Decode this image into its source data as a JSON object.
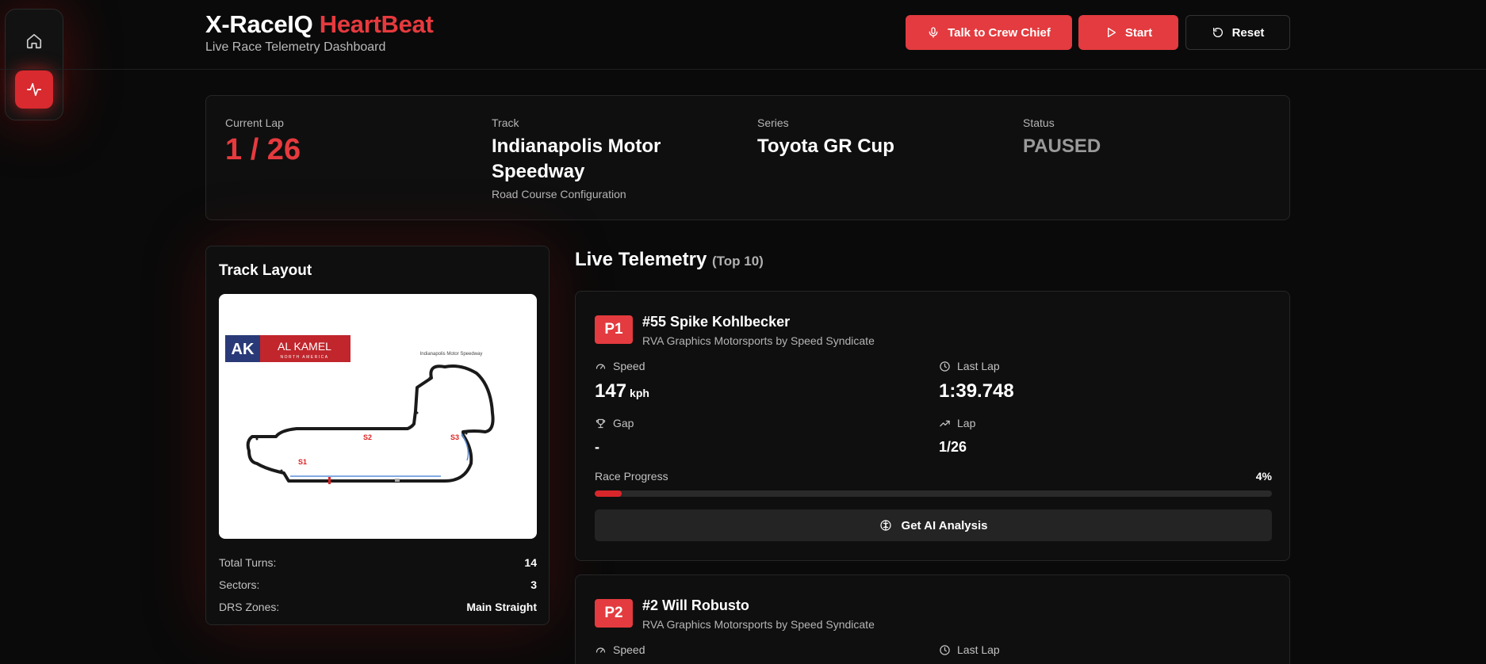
{
  "app": {
    "title_main": "X-RaceIQ",
    "title_accent": "HeartBeat",
    "subtitle": "Live Race Telemetry Dashboard"
  },
  "nav": {
    "items": [
      {
        "icon": "home-icon"
      },
      {
        "icon": "activity-icon",
        "active": true
      }
    ]
  },
  "header": {
    "crew_label": "Talk to Crew Chief",
    "start_label": "Start",
    "reset_label": "Reset"
  },
  "race_info": {
    "lap_label": "Current Lap",
    "lap_value": "1 / 26",
    "track_label": "Track",
    "track_value": "Indianapolis Motor Speedway",
    "track_sub": "Road Course Configuration",
    "series_label": "Series",
    "series_value": "Toyota GR Cup",
    "status_label": "Status",
    "status_value": "PAUSED"
  },
  "track_layout": {
    "title": "Track Layout",
    "logo_ak": "AK",
    "logo_name": "AL KAMEL",
    "logo_sub": "NORTH AMERICA",
    "map_title": "Indianapolis Motor Speedway",
    "sector_labels": [
      "S1",
      "S2",
      "S3"
    ],
    "stats": [
      {
        "label": "Total Turns:",
        "value": "14"
      },
      {
        "label": "Sectors:",
        "value": "3"
      },
      {
        "label": "DRS Zones:",
        "value": "Main Straight"
      }
    ]
  },
  "telemetry": {
    "title": "Live Telemetry",
    "title_sub": "(Top 10)",
    "progress_label": "Race Progress",
    "ai_label": "Get AI Analysis",
    "speed_label": "Speed",
    "last_lap_label": "Last Lap",
    "gap_label": "Gap",
    "lap_label": "Lap",
    "drivers": [
      {
        "position": "P1",
        "name": "#55 Spike Kohlbecker",
        "team": "RVA Graphics Motorsports by Speed Syndicate",
        "speed": "147",
        "speed_unit": "kph",
        "last_lap": "1:39.748",
        "gap": "-",
        "lap": "1/26",
        "progress_text": "4%",
        "progress": 0.04
      },
      {
        "position": "P2",
        "name": "#2 Will Robusto",
        "team": "RVA Graphics Motorsports by Speed Syndicate"
      }
    ]
  },
  "colors": {
    "accent": "#e33b3f",
    "background": "#0a0a0a",
    "card": "#0f0f0f"
  }
}
